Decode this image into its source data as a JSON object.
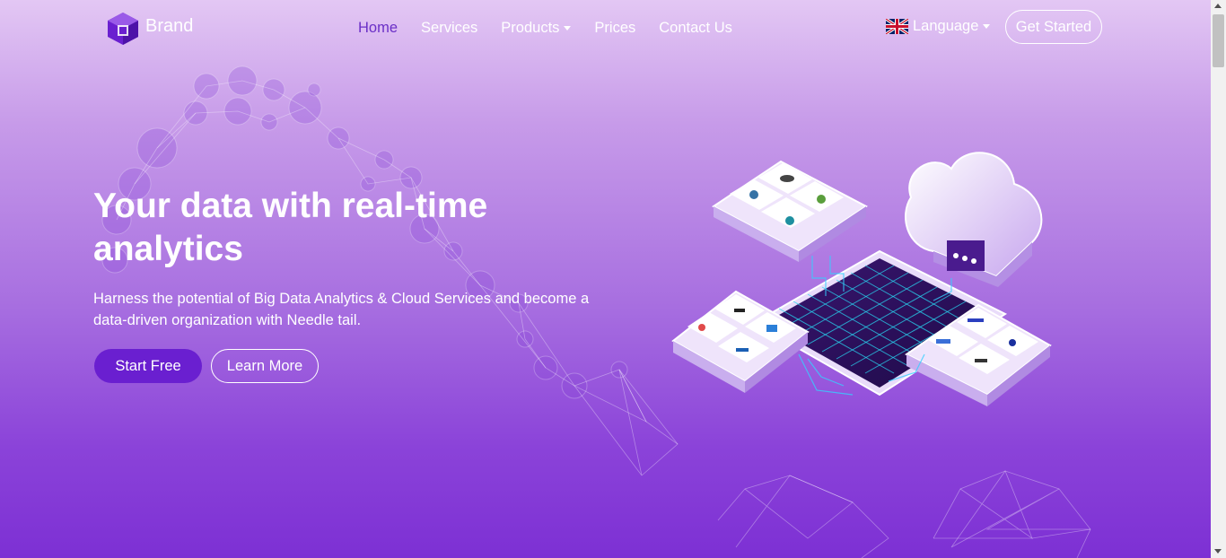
{
  "brand": {
    "name": "Brand",
    "logo_icon": "cube-logo-icon"
  },
  "nav": {
    "home": "Home",
    "services": "Services",
    "products": "Products",
    "prices": "Prices",
    "contact": "Contact Us"
  },
  "language": {
    "label": "Language",
    "flag_icon": "uk-flag-icon"
  },
  "get_started": "Get Started",
  "hero": {
    "title": "Your data with real-time analytics",
    "subtitle": "Harness the potential of Big Data Analytics & Cloud Services and become a data-driven organization with Needle tail.",
    "start_free": "Start Free",
    "learn_more": "Learn More"
  },
  "colors": {
    "accent": "#6a1fd0",
    "active_nav": "#6a2fc7",
    "bg_top": "#e3c7f4",
    "bg_bottom": "#7d30d4"
  }
}
